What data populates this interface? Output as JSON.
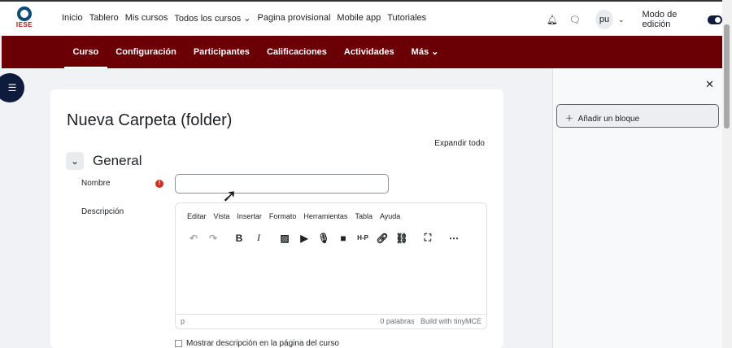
{
  "brand": {
    "logo_text": "IESE"
  },
  "nav": {
    "items": [
      "Inicio",
      "Tablero",
      "Mis cursos",
      "Todos los cursos ⌄",
      "Pagina provisional",
      "Mobile app",
      "Tutoriales"
    ]
  },
  "user": {
    "avatar": "pu",
    "edit_mode_label": "Modo de edición",
    "edit_mode_on": true
  },
  "secondary_nav": {
    "items": [
      "Curso",
      "Configuración",
      "Participantes",
      "Calificaciones",
      "Actividades",
      "Más ⌄"
    ],
    "active": "Curso"
  },
  "page": {
    "title": "Nueva Carpeta (folder)",
    "expand_all": "Expandir todo",
    "section": "General",
    "name_label": "Nombre",
    "name_value": "",
    "description_label": "Descripción",
    "show_description_label": "Mostrar descripción en la página del curso"
  },
  "editor": {
    "menu": [
      "Editar",
      "Vista",
      "Insertar",
      "Formato",
      "Herramientas",
      "Tabla",
      "Ayuda"
    ],
    "tools": [
      "undo-icon",
      "redo-icon",
      "bold-icon",
      "italic-icon",
      "image-icon",
      "media-icon",
      "microphone-icon",
      "video-icon",
      "h5p-icon",
      "link-icon",
      "unlink-icon",
      "fullscreen-icon",
      "more-icon"
    ],
    "path": "p",
    "word_count": "0 palabras",
    "branding": "Build with tinyMCE"
  },
  "drawer": {
    "add_block": "Añadir un bloque"
  },
  "colors": {
    "brand": "#6a0005",
    "accent": "#0f1b3d"
  }
}
